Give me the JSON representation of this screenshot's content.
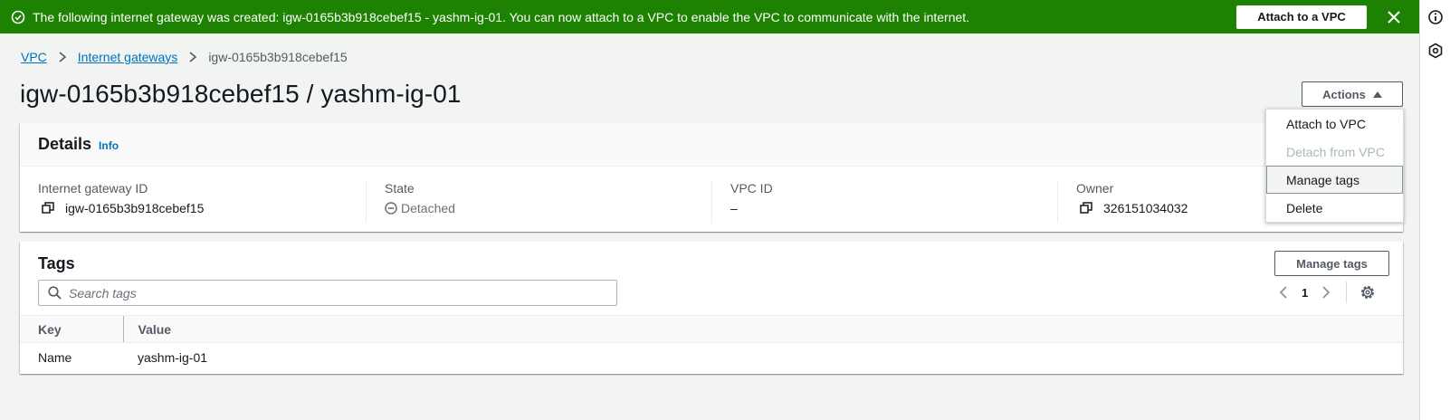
{
  "flash": {
    "message": "The following internet gateway was created: igw-0165b3b918cebef15 - yashm-ig-01. You can now attach to a VPC to enable the VPC to communicate with the internet.",
    "attach_button": "Attach to a VPC",
    "color": "#1d8102"
  },
  "breadcrumb": {
    "root": "VPC",
    "parent": "Internet gateways",
    "current": "igw-0165b3b918cebef15"
  },
  "page": {
    "title": "igw-0165b3b918cebef15 / yashm-ig-01",
    "actions_label": "Actions"
  },
  "actions_menu": [
    {
      "label": "Attach to VPC",
      "disabled": false
    },
    {
      "label": "Detach from VPC",
      "disabled": true
    },
    {
      "label": "Manage tags",
      "disabled": false
    },
    {
      "label": "Delete",
      "disabled": false
    }
  ],
  "details": {
    "title": "Details",
    "info": "Info",
    "fields": [
      {
        "label": "Internet gateway ID",
        "value": "igw-0165b3b918cebef15",
        "icon": "copy-icon"
      },
      {
        "label": "State",
        "value": "Detached",
        "icon": "status-stopped-icon"
      },
      {
        "label": "VPC ID",
        "value": "–",
        "icon": ""
      },
      {
        "label": "Owner",
        "value": "326151034032",
        "icon": "copy-icon"
      }
    ]
  },
  "tags": {
    "title": "Tags",
    "manage_button": "Manage tags",
    "search_placeholder": "Search tags",
    "page_number": "1",
    "columns": [
      "Key",
      "Value"
    ],
    "rows": [
      {
        "key": "Name",
        "value": "yashm-ig-01"
      }
    ]
  },
  "colors": {
    "link": "#0073bb",
    "background": "#f2f3f3"
  }
}
